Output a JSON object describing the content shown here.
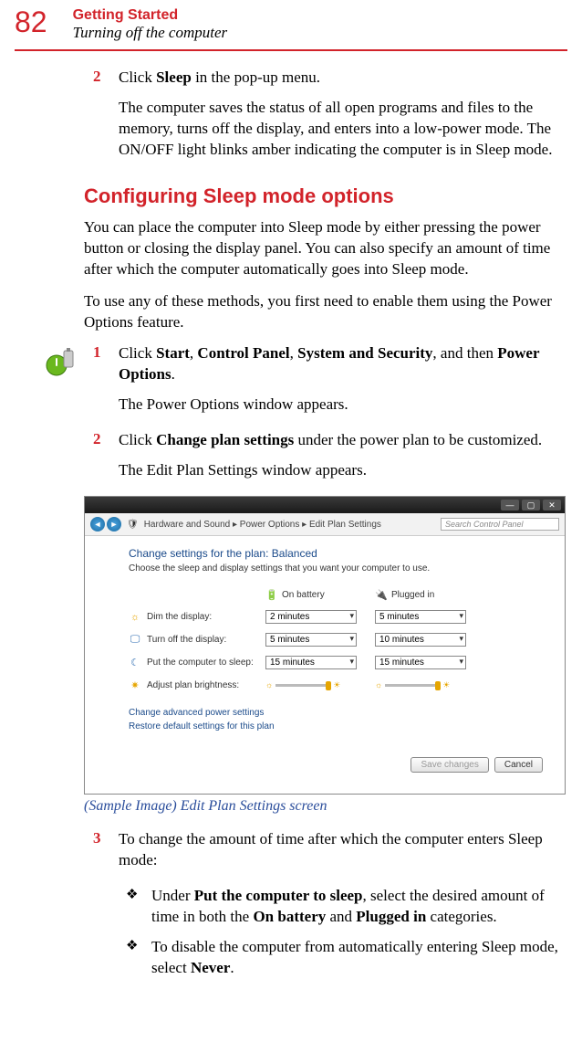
{
  "header": {
    "page_number": "82",
    "chapter": "Getting Started",
    "subchapter": "Turning off the computer"
  },
  "step_top": {
    "num": "2",
    "line1_pre": "Click ",
    "line1_bold": "Sleep",
    "line1_post": " in the pop-up menu.",
    "para": "The computer saves the status of all open programs and files to the memory, turns off the display, and enters into a low-power mode. The ON/OFF light blinks amber indicating the computer is in Sleep mode."
  },
  "section_heading": "Configuring Sleep mode options",
  "body_para1": "You can place the computer into Sleep mode by either pressing the power button or closing the display panel. You can also specify an amount of time after which the computer automatically goes into Sleep mode.",
  "body_para2": "To use any of these methods, you first need to enable them using the Power Options feature.",
  "step_c1": {
    "num": "1",
    "text_pre": "Click ",
    "b1": "Start",
    "c1": ", ",
    "b2": "Control Panel",
    "c2": ", ",
    "b3": "System and Security",
    "c3": ", and then ",
    "b4": "Power Options",
    "c4": ".",
    "after": "The Power Options window appears."
  },
  "step_c2": {
    "num": "2",
    "text_pre": "Click ",
    "b1": "Change plan settings",
    "text_post": " under the power plan to be customized.",
    "after": "The Edit Plan Settings window appears."
  },
  "screenshot": {
    "breadcrumb": "Hardware and Sound  ▸  Power Options  ▸  Edit Plan Settings",
    "search_placeholder": "Search Control Panel",
    "plan_title": "Change settings for the plan: Balanced",
    "plan_desc": "Choose the sleep and display settings that you want your computer to use.",
    "col_battery": "On battery",
    "col_plugged": "Plugged in",
    "row_dim": "Dim the display:",
    "row_off": "Turn off the display:",
    "row_sleep": "Put the computer to sleep:",
    "row_bright": "Adjust plan brightness:",
    "vals": {
      "dim_bat": "2 minutes",
      "dim_plug": "5 minutes",
      "off_bat": "5 minutes",
      "off_plug": "10 minutes",
      "sleep_bat": "15 minutes",
      "sleep_plug": "15 minutes"
    },
    "link_advanced": "Change advanced power settings",
    "link_restore": "Restore default settings for this plan",
    "btn_save": "Save changes",
    "btn_cancel": "Cancel"
  },
  "caption": "(Sample Image) Edit Plan Settings screen",
  "step3": {
    "num": "3",
    "text": "To change the amount of time after which the computer enters Sleep mode:"
  },
  "bullet1": {
    "pre": "Under ",
    "b1": "Put the computer to sleep",
    "mid": ", select the desired amount of time in both the ",
    "b2": "On battery",
    "mid2": " and ",
    "b3": "Plugged in",
    "post": " categories."
  },
  "bullet2": {
    "pre": "To disable the computer from automatically entering Sleep mode, select ",
    "b1": "Never",
    "post": "."
  }
}
